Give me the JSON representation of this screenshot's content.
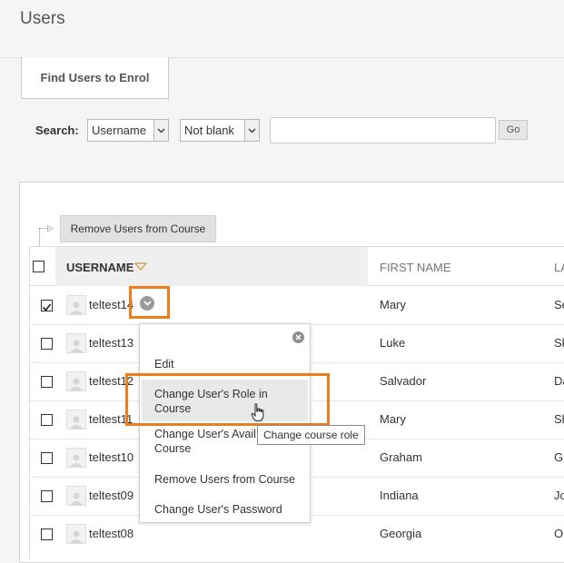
{
  "page": {
    "title": "Users"
  },
  "actions": {
    "find_users": "Find Users to Enrol"
  },
  "search": {
    "label": "Search:",
    "field_select": "Username",
    "condition_select": "Not blank",
    "value": "",
    "go_label": "Go"
  },
  "bulk": {
    "remove_label": "Remove Users from Course"
  },
  "table": {
    "headers": {
      "username": "USERNAME",
      "first_name": "FIRST NAME",
      "last_name": "LA"
    },
    "rows": [
      {
        "username": "teltest14",
        "first": "Mary",
        "last": "Se",
        "checked": true
      },
      {
        "username": "teltest13",
        "first": "Luke",
        "last": "Sk",
        "checked": false
      },
      {
        "username": "teltest12",
        "first": "Salvador",
        "last": "Da",
        "checked": false
      },
      {
        "username": "teltest11",
        "first": "Mary",
        "last": "Sh",
        "checked": false
      },
      {
        "username": "teltest10",
        "first": "Graham",
        "last": "Gr",
        "checked": false
      },
      {
        "username": "teltest09",
        "first": "Indiana",
        "last": "Jo",
        "checked": false
      },
      {
        "username": "teltest08",
        "first": "Georgia",
        "last": "O",
        "checked": false
      }
    ]
  },
  "context_menu": {
    "items": [
      {
        "label": "Edit"
      },
      {
        "label_line1": "Change User's Role in",
        "label_line2": "Course"
      },
      {
        "label_line1": "Change User's Avail",
        "label_line2": "Course"
      },
      {
        "label": "Remove Users from Course"
      },
      {
        "label": "Change User's Password"
      }
    ]
  },
  "tooltip": {
    "text": "Change course role"
  },
  "colors": {
    "highlight": "#f07d1b"
  }
}
